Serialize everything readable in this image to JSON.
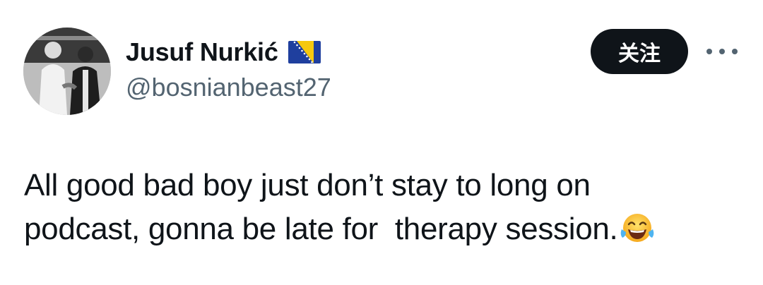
{
  "author": {
    "display_name": "Jusuf Nurkić",
    "flag_icon": "bosnia-flag-icon",
    "handle": "@bosnianbeast27"
  },
  "actions": {
    "follow_label": "关注",
    "more_icon": "more-horizontal-icon"
  },
  "tweet": {
    "lines": [
      "All good bad boy just don’t stay to long on",
      "podcast, gonna be late for  therapy session."
    ],
    "emoji": "face-with-tears-of-joy-icon"
  },
  "colors": {
    "text": "#0f1419",
    "secondary": "#536471",
    "button_bg": "#0f1419",
    "button_text": "#ffffff"
  }
}
